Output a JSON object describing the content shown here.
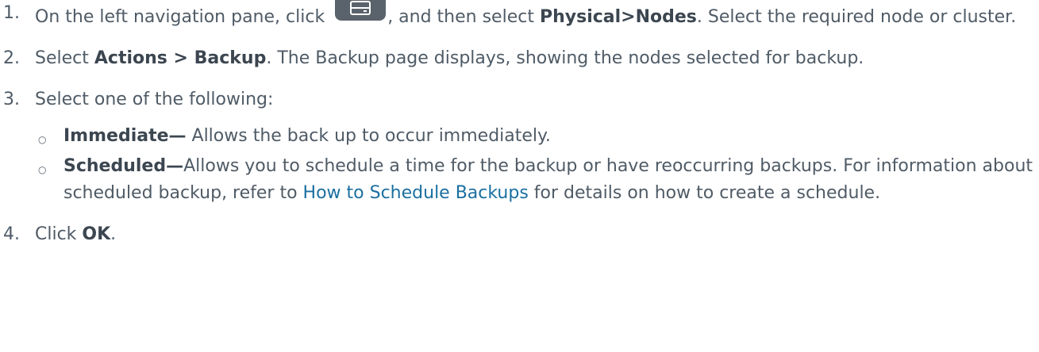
{
  "steps": [
    {
      "num": "1.",
      "text_before_icon": "On the left navigation pane, click ",
      "icon": "server-icon",
      "text_after_icon": ", and then select ",
      "bold": "Physical>Nodes",
      "text_end": ". Select the required node or cluster."
    },
    {
      "num": "2.",
      "text_before": "Select ",
      "bold": "Actions > Backup",
      "text_after": ". The Backup page displays, showing the nodes selected for backup."
    },
    {
      "num": "3.",
      "text": "Select one of the following:",
      "options": [
        {
          "bold": "Immediate—",
          "text": " Allows the back up to occur immediately."
        },
        {
          "bold": "Scheduled—",
          "text": "Allows you to schedule a time for the backup or have reoccurring backups. For information about scheduled backup, refer to ",
          "link": "How to Schedule Backups",
          "text_after": " for details on how to create a schedule."
        }
      ]
    },
    {
      "num": "4.",
      "text_before": "Click ",
      "bold": "OK",
      "text_after": "."
    }
  ],
  "colors": {
    "body_text": "#4f5b66",
    "link": "#1a6fa0",
    "icon_fill": "#5a636b"
  }
}
